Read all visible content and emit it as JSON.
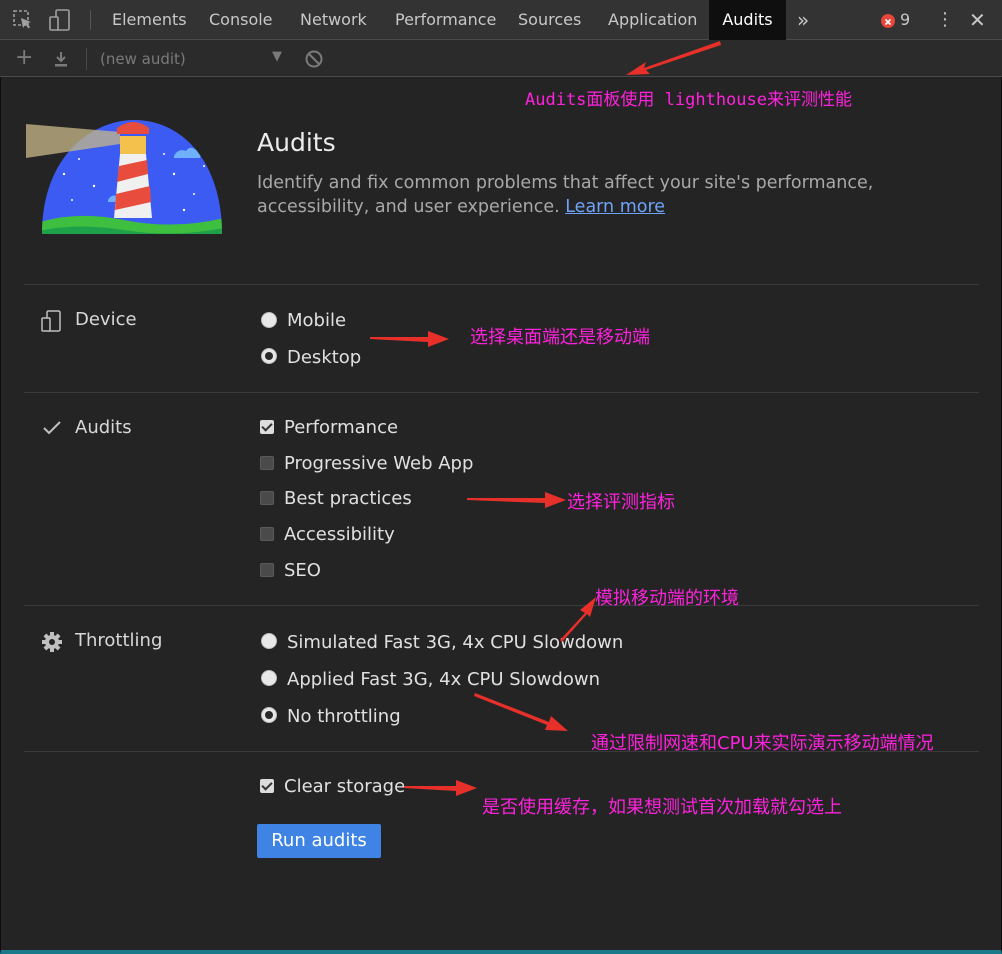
{
  "tabs": [
    {
      "label": "Elements"
    },
    {
      "label": "Console"
    },
    {
      "label": "Network"
    },
    {
      "label": "Performance"
    },
    {
      "label": "Sources"
    },
    {
      "label": "Application"
    },
    {
      "label": "Audits"
    }
  ],
  "error_count": "9",
  "toolbar": {
    "audit_select": "(new audit)"
  },
  "header": {
    "title": "Audits",
    "description": "Identify and fix common problems that affect your site's performance, accessibility, and user experience.",
    "learn_more": "Learn more"
  },
  "device": {
    "label": "Device",
    "options": [
      {
        "label": "Mobile",
        "checked": false
      },
      {
        "label": "Desktop",
        "checked": true
      }
    ]
  },
  "audits": {
    "label": "Audits",
    "options": [
      {
        "label": "Performance",
        "checked": true
      },
      {
        "label": "Progressive Web App",
        "checked": false
      },
      {
        "label": "Best practices",
        "checked": false
      },
      {
        "label": "Accessibility",
        "checked": false
      },
      {
        "label": "SEO",
        "checked": false
      }
    ]
  },
  "throttling": {
    "label": "Throttling",
    "options": [
      {
        "label": "Simulated Fast 3G, 4x CPU Slowdown",
        "checked": false
      },
      {
        "label": "Applied Fast 3G, 4x CPU Slowdown",
        "checked": false
      },
      {
        "label": "No throttling",
        "checked": true
      }
    ]
  },
  "clear_storage": {
    "label": "Clear storage",
    "checked": true
  },
  "run_button": "Run audits",
  "annotations": {
    "audits_panel": "Audits面板使用 lighthouse来评测性能",
    "device": "选择桌面端还是移动端",
    "metrics": "选择评测指标",
    "simulate": "模拟移动端的环境",
    "throttle": "通过限制网速和CPU来实际演示移动端情况",
    "cache": "是否使用缓存，如果想测试首次加载就勾选上"
  },
  "colors": {
    "accent": "#3f84e5",
    "annotation": "#ff22dd",
    "arrow": "#e8302a",
    "background": "#242424"
  }
}
